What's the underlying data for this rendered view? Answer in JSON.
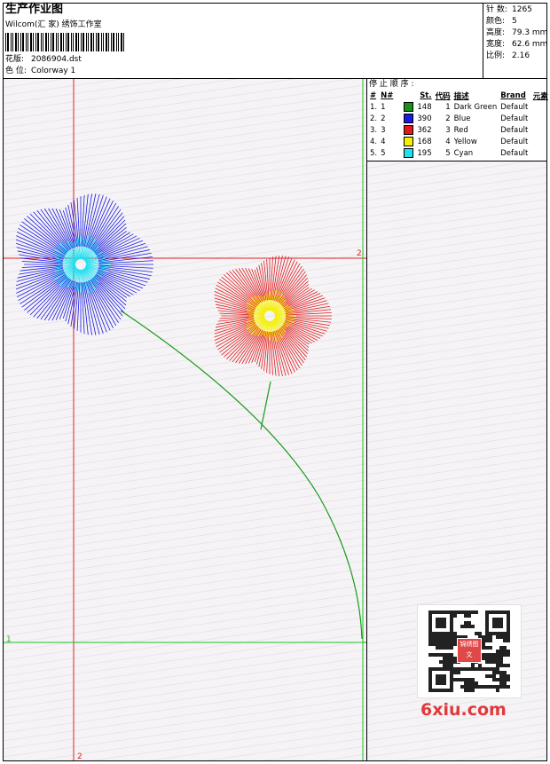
{
  "header": {
    "title": "生产作业图",
    "company": "Wilcom(汇 家) 绣饰工作室",
    "design_label": "花版:",
    "design_value": "2086904.dst",
    "color_label": "色 位:",
    "color_value": "Colorway 1"
  },
  "stats": [
    {
      "label": "针 数:",
      "value": "1265"
    },
    {
      "label": "颜色:",
      "value": "5"
    },
    {
      "label": "高度:",
      "value": "79.3 mm"
    },
    {
      "label": "宽度:",
      "value": "62.6 mm"
    },
    {
      "label": "比例:",
      "value": "2.16"
    }
  ],
  "stop_sequence": {
    "title": "停 止 顺 序 :",
    "headers": [
      "#",
      "N#",
      "St.",
      "代码",
      "描述",
      "Brand",
      "元素"
    ],
    "rows": [
      {
        "num": "1.",
        "n": "1",
        "color": "#1a8f1a",
        "st": "148",
        "code": "1",
        "desc": "Dark Green",
        "brand": "Default"
      },
      {
        "num": "2.",
        "n": "2",
        "color": "#1a1ae0",
        "st": "390",
        "code": "2",
        "desc": "Blue",
        "brand": "Default"
      },
      {
        "num": "3.",
        "n": "3",
        "color": "#e01a1a",
        "st": "362",
        "code": "3",
        "desc": "Red",
        "brand": "Default"
      },
      {
        "num": "4.",
        "n": "4",
        "color": "#f5f000",
        "st": "168",
        "code": "4",
        "desc": "Yellow",
        "brand": "Default"
      },
      {
        "num": "5.",
        "n": "5",
        "color": "#20e0f0",
        "st": "195",
        "code": "5",
        "desc": "Cyan",
        "brand": "Default"
      }
    ]
  },
  "guides": {
    "red_h_label": "2",
    "red_v_label": "2",
    "green_h_label": "1"
  },
  "watermark": {
    "logo_text": "6xiu.com",
    "seal_text": "锦绣图文"
  },
  "colors": {
    "red_guide": "#e02020",
    "green_guide": "#20c020",
    "stem": "#1a9a1a"
  }
}
